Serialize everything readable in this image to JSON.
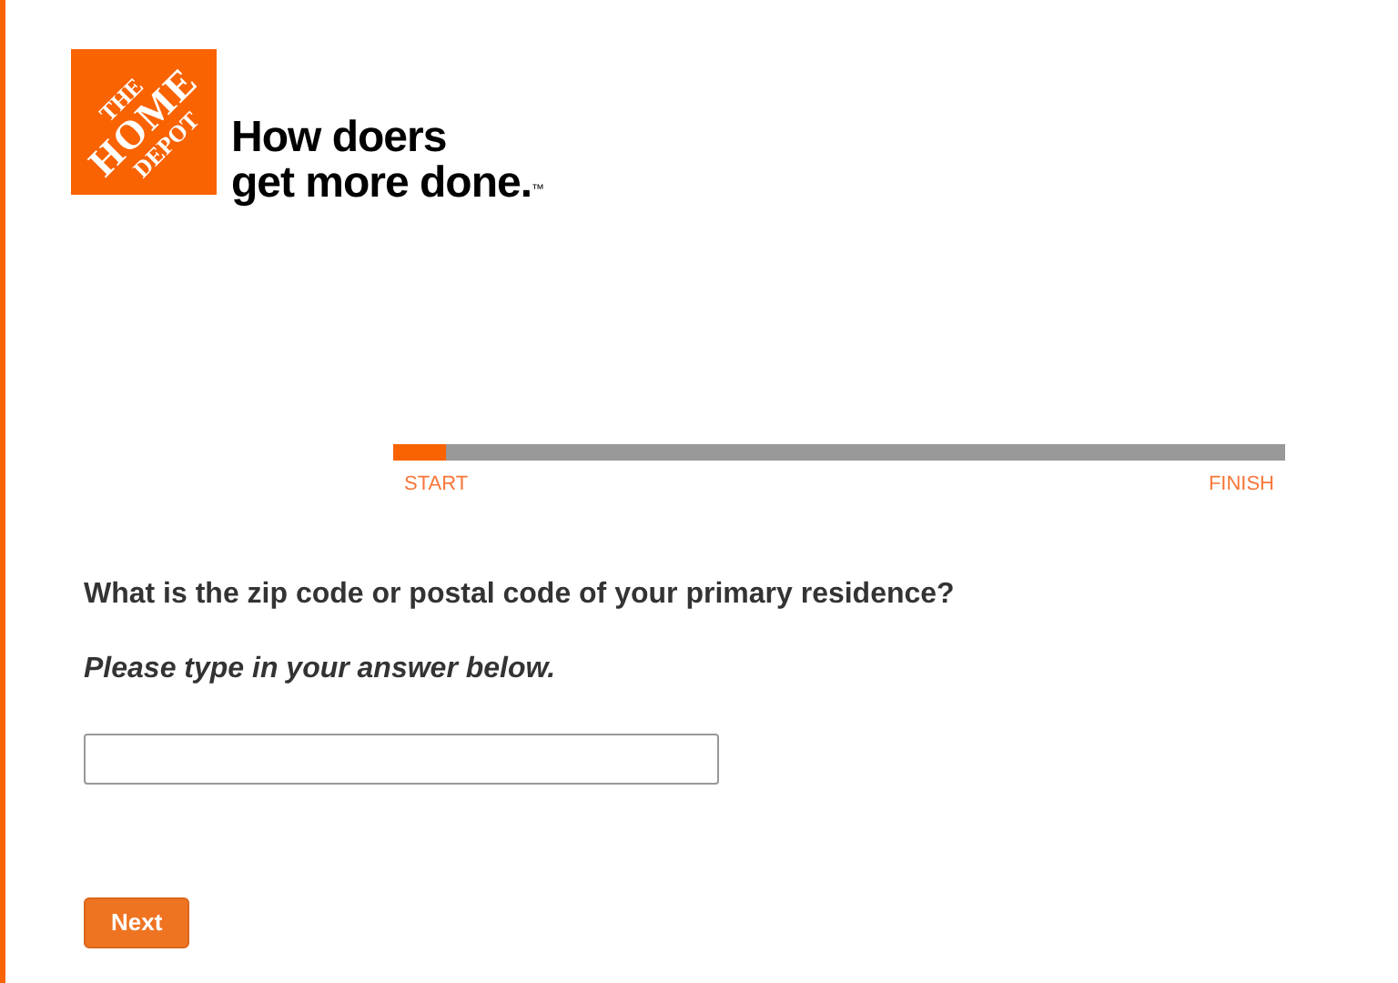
{
  "logo": {
    "lines": [
      "THE",
      "HOME",
      "DEPOT"
    ],
    "tagline": [
      "How doers",
      "get more done."
    ],
    "trademark": "™"
  },
  "progress": {
    "level": 0.06,
    "start_label": "START",
    "finish_label": "FINISH"
  },
  "question": "What is the zip code or postal code of your primary residence?",
  "instruction": "Please type in your answer below.",
  "buttons": [
    {
      "label": "Next"
    }
  ]
}
